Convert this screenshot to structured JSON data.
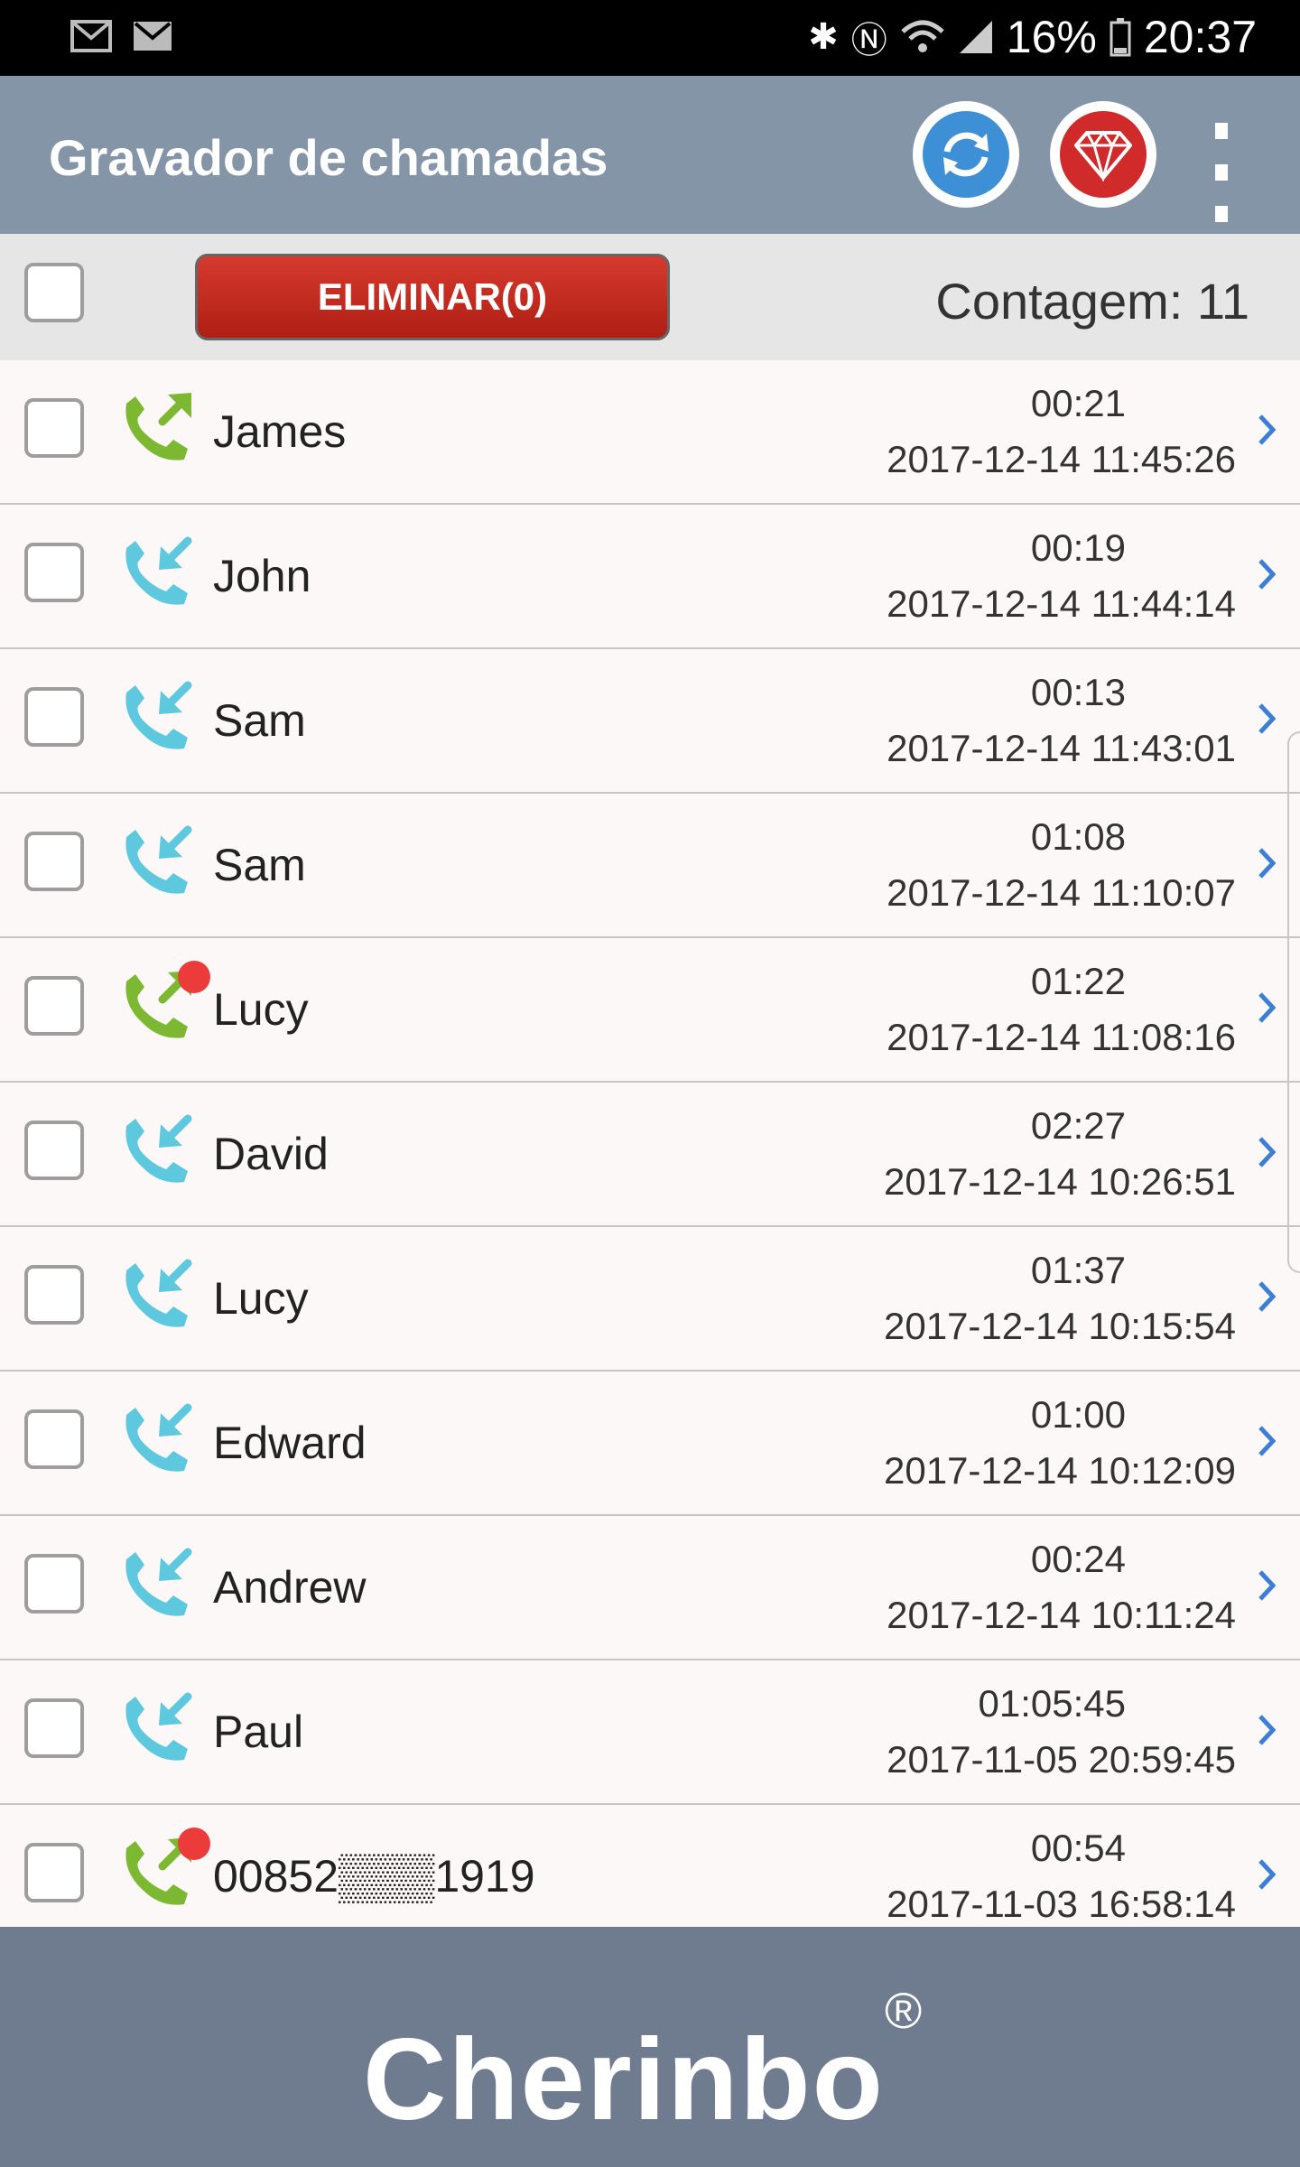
{
  "status_bar": {
    "battery": "16%",
    "time": "20:37",
    "left_icons": [
      "gmail-icon",
      "mail-icon"
    ],
    "right_icons": [
      "bluetooth-icon",
      "nfc-icon",
      "wifi-icon",
      "signal-icon",
      "battery-icon"
    ]
  },
  "app_bar": {
    "title": "Gravador de chamadas",
    "sync_icon": "sync-icon",
    "premium_icon": "diamond-icon",
    "menu_icon": "more-vert-icon",
    "colors": {
      "background": "#8595a8",
      "sync": "#3d8fd6",
      "premium": "#d02a2a"
    }
  },
  "toolbar": {
    "delete_label": "ELIMINAR(0)",
    "count_label": "Contagem: 11"
  },
  "calls": [
    {
      "name": "James",
      "duration": "00:21",
      "datetime": "2017-12-14 11:45:26",
      "direction": "outgoing",
      "unread": false
    },
    {
      "name": "John",
      "duration": "00:19",
      "datetime": "2017-12-14 11:44:14",
      "direction": "incoming",
      "unread": false
    },
    {
      "name": "Sam",
      "duration": "00:13",
      "datetime": "2017-12-14 11:43:01",
      "direction": "incoming",
      "unread": false
    },
    {
      "name": "Sam",
      "duration": "01:08",
      "datetime": "2017-12-14 11:10:07",
      "direction": "incoming",
      "unread": false
    },
    {
      "name": "Lucy",
      "duration": "01:22",
      "datetime": "2017-12-14 11:08:16",
      "direction": "outgoing",
      "unread": true
    },
    {
      "name": "David",
      "duration": "02:27",
      "datetime": "2017-12-14 10:26:51",
      "direction": "incoming",
      "unread": false
    },
    {
      "name": "Lucy",
      "duration": "01:37",
      "datetime": "2017-12-14 10:15:54",
      "direction": "incoming",
      "unread": false
    },
    {
      "name": "Edward",
      "duration": "01:00",
      "datetime": "2017-12-14 10:12:09",
      "direction": "incoming",
      "unread": false
    },
    {
      "name": "Andrew",
      "duration": "00:24",
      "datetime": "2017-12-14 10:11:24",
      "direction": "incoming",
      "unread": false
    },
    {
      "name": "Paul",
      "duration": "01:05:45",
      "datetime": "2017-11-05 20:59:45",
      "direction": "incoming",
      "unread": false
    },
    {
      "name": "00852▒▒▒1919",
      "duration": "00:54",
      "datetime": "2017-11-03 16:58:14",
      "direction": "outgoing",
      "unread": true
    }
  ],
  "call_colors": {
    "outgoing": "#7cb832",
    "incoming": "#5ec8de",
    "unread_dot": "#ec3b3b"
  },
  "footer": {
    "brand": "Cherinbo",
    "registered": "®"
  }
}
